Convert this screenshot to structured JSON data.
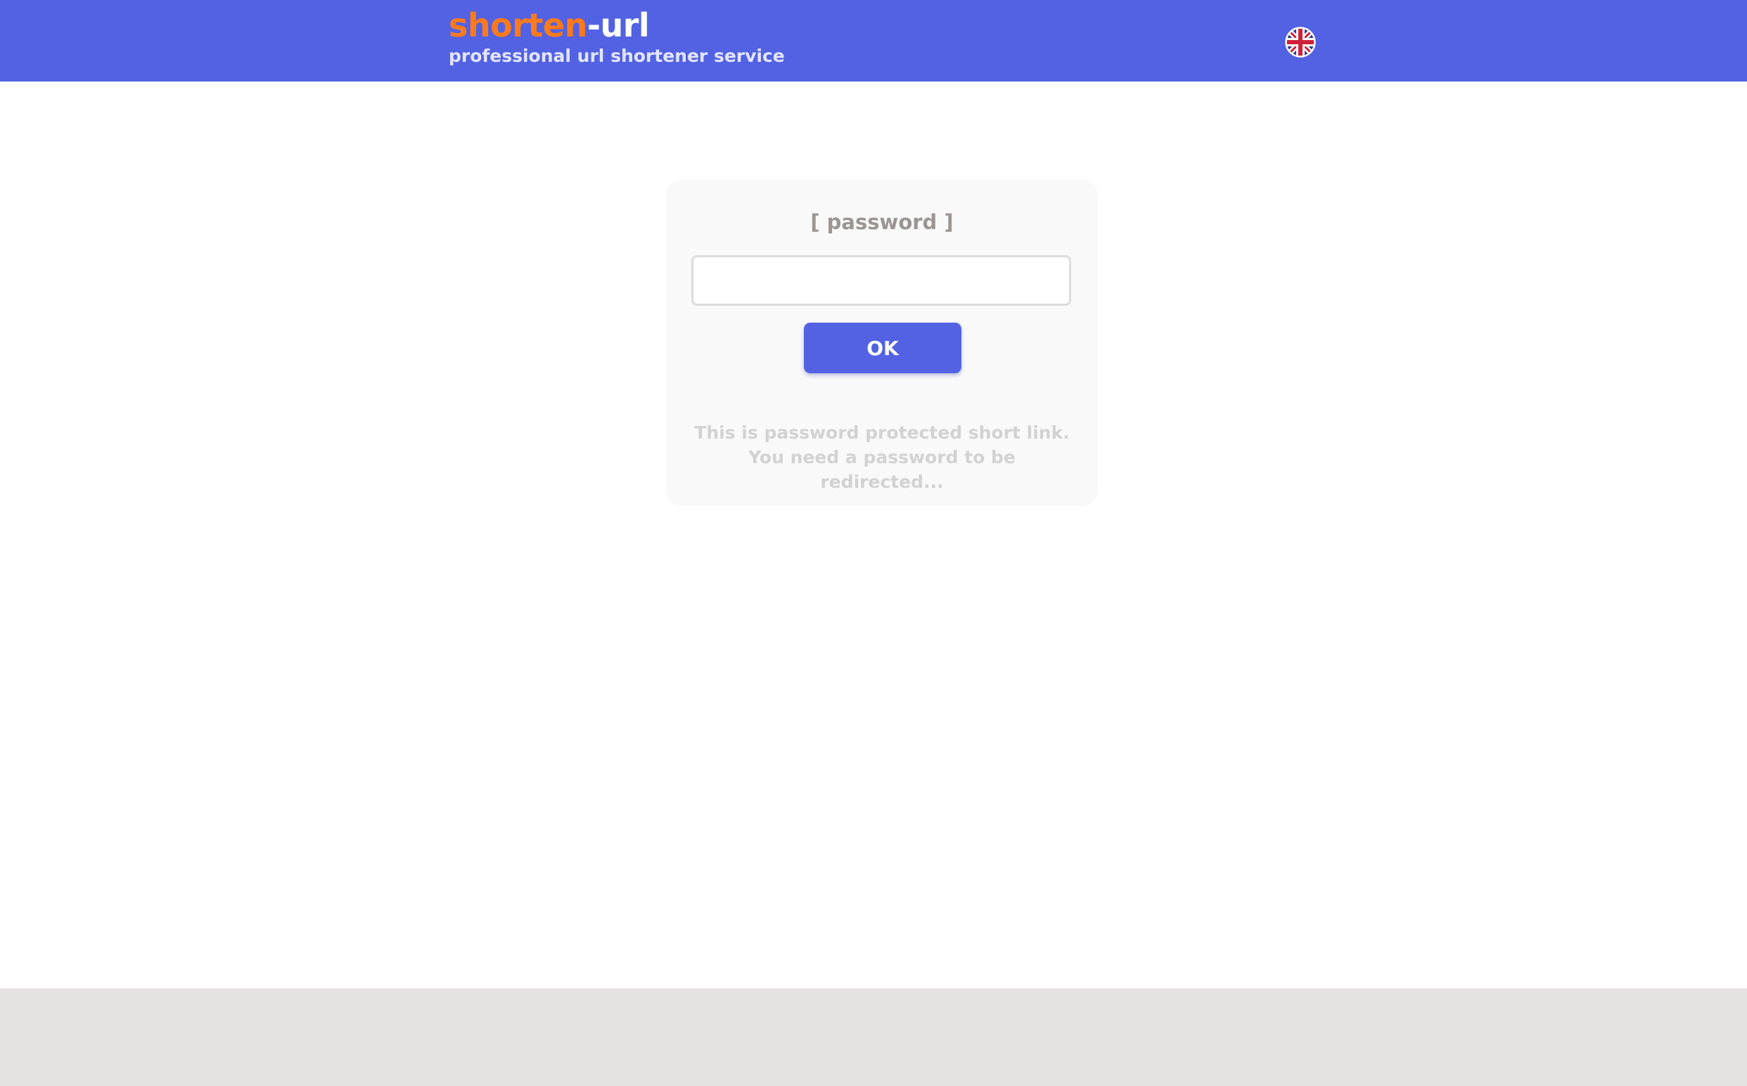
{
  "header": {
    "logo_part1": "shorten",
    "logo_part2": "-url",
    "tagline": "professional url shortener service",
    "language_icon": "uk-flag-icon"
  },
  "card": {
    "title": "[ password ]",
    "password_value": "",
    "ok_label": "OK",
    "info_text": "This is password protected short link. You need a password to be redirected..."
  },
  "colors": {
    "accent": "#5262e3",
    "logo_orange": "#ff7a1a",
    "card_bg": "#f9f9f9",
    "footer_bg": "#e6e2e2"
  }
}
